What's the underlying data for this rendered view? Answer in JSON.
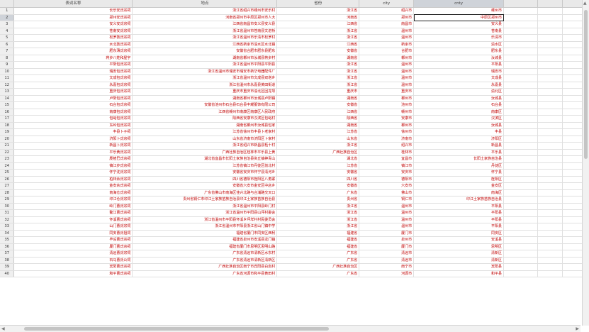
{
  "columns": [
    "表词名称",
    "地点",
    "省份",
    "city",
    "cnty"
  ],
  "rows": [
    [
      "长乐安氏宗祠",
      "浙江省绍兴市嵊州市安乐村",
      "浙江省",
      "绍兴市",
      "嵊州市"
    ],
    [
      "郑州安氏宗祠",
      "河南省郑州市中原区郑州市人大",
      "河南省",
      "郑州市",
      "中原区郑州市"
    ],
    [
      "安义安氏宗祠",
      "江西省南昌市安义县安义县",
      "江西省",
      "南昌市",
      "安义县"
    ],
    [
      "苍南安氏宗祠",
      "浙江省温州市苍南县文进桥",
      "浙江省",
      "温州市",
      "苍南县"
    ],
    [
      "松罗敦氏宗祠",
      "浙江省温州市乐清市松罗村",
      "浙江省",
      "温州市",
      "乐清市"
    ],
    [
      "水北敦氏宗祠",
      "江西省新余市渝水区水北镇",
      "江西省",
      "新余市",
      "渝水区"
    ],
    [
      "肥东薄氏宗祠",
      "安徽省合肥市肥东县肥东",
      "安徽省",
      "合肥市",
      "肥东县"
    ],
    [
      "蒋步八姓和屋宇",
      "湖南省郴州市汝城县蒋步村",
      "湖南省",
      "郴州市",
      "汝城县"
    ],
    [
      "平阳包氏宗祠",
      "浙江省温州市平阳县平阳县",
      "浙江省",
      "温州市",
      "平阳县"
    ],
    [
      "瑞安包氏宗祠",
      "浙江省温州市瑞安市瑞安市新华电器配件厂",
      "浙江省",
      "温州市",
      "瑞安市"
    ],
    [
      "文成包氏宗祠",
      "浙江省温州市文成县双塔乡",
      "浙江省",
      "温州市",
      "文成县"
    ],
    [
      "永嘉包氏宗祠",
      "浙江省温州市永嘉县黄田街道",
      "浙江省",
      "温州市",
      "永嘉县"
    ],
    [
      "重庆包氏宗祠",
      "重庆市重庆市渝北区回龙坝",
      "重庆市",
      "重庆市",
      "渝北区"
    ],
    [
      "卢阳包氏宗祠",
      "湖南省郴州市汝城县卢阳镇",
      "湖南省",
      "郴州市",
      "汝城县"
    ],
    [
      "石台包氏宗祠",
      "安徽省池州市石台县石台县丰耀服饰有限公司",
      "安徽省",
      "池州市",
      "石台县"
    ],
    [
      "南康包氏宗祠",
      "江西省赣州市南康区南康区人民政府",
      "江西省",
      "赣州市",
      "南康区"
    ],
    [
      "包峪包氏宗祠",
      "陕西省安康市汉滨区包峪村",
      "陕西省",
      "安康市",
      "汉滨区"
    ],
    [
      "东岭包氏宗祠",
      "湖南省郴州市汝城县包家",
      "湖南省",
      "郴州市",
      "汝城县"
    ],
    [
      "丰县卜子祠",
      "江苏省徐州市丰县卜老家村",
      "江苏省",
      "徐州市",
      "丰县"
    ],
    [
      "济阳卜氏宗祠",
      "山东省济南市济阳区卜家村",
      "山东省",
      "济南市",
      "济阳区"
    ],
    [
      "新昌卜氏宗祠",
      "浙江省绍兴市新昌县柘十村",
      "浙江省",
      "绍兴市",
      "新昌县"
    ],
    [
      "平乐黄氏宗祠",
      "广西壮族自治区桂林市平乐县上黄",
      "广西壮族自治区",
      "桂林市",
      "平乐县"
    ],
    [
      "麂楂巴氏宗祠",
      "湖北省宜昌市长阳土家族自治县资丘镇神青山",
      "湖北省",
      "宜昌市",
      "长阳土家族自治县"
    ],
    [
      "镇江步氏宗祠",
      "江苏省镇江市丹徒区前北村",
      "江苏省",
      "镇江市",
      "丹徒区"
    ],
    [
      "怀宁沈氏宗祠",
      "安徽省安庆市怀宁县清河乡",
      "安徽省",
      "安庆市",
      "怀宁县"
    ],
    [
      "柏林余氏宗祠",
      "四川省德阳市旌阳区八角寨",
      "四川省",
      "德阳市",
      "旌阳区"
    ],
    [
      "金安余氏宗祠",
      "安徽省六安市金安区中店乡",
      "安徽省",
      "六安市",
      "金安区"
    ],
    [
      "南海仓氏宗祠",
      "广东省佛山市南海区佳兴北路与合浦路交叉口",
      "广东省",
      "佛山市",
      "南海区"
    ],
    [
      "印江仓氏宗祠",
      "贵州省铜仁市印江土家族苗族自治县印江土家族苗族自治县",
      "贵州省",
      "铜仁市",
      "印江土家族苗族自治县"
    ],
    [
      "岭门曹氏宗祠",
      "浙江省温州市平阳县岭门村",
      "浙江省",
      "温州市",
      "平阳县"
    ],
    [
      "鳌江曹氏宗祠",
      "浙江省温州市平阳县山坪村委会",
      "浙江省",
      "温州市",
      "平阳县"
    ],
    [
      "怀溪曹氏宗祠",
      "浙江省温州市平阳县怀溪乡坪垟村村民委员会",
      "浙江省",
      "温州市",
      "平阳县"
    ],
    [
      "山门曹氏宗祠",
      "浙江省温州市平阳县浙江省山门镇中学",
      "浙江省",
      "温州市",
      "平阳县"
    ],
    [
      "同安曹氏祖祠",
      "福建省厦门市同安区西柯",
      "福建省",
      "厦门市",
      "同安区"
    ],
    [
      "毕设曹氏宗祠",
      "福建省泉州市安溪县龙门镇",
      "福建省",
      "泉州市",
      "安溪县"
    ],
    [
      "厦门曹氏宗祠",
      "福建省厦门市思明区思明山路",
      "福建省",
      "厦门市",
      "思明区"
    ],
    [
      "清远曹氏宗祠",
      "广东省清远市清新区水东村",
      "广东省",
      "清远市",
      "清新区"
    ],
    [
      "石马曹氏公祠",
      "广东省清远市清新区清新区",
      "广东省",
      "清远市",
      "清新区"
    ],
    [
      "宾阳曹氏宗祠",
      "广西壮族自治区南宁市宾阳县白岩村",
      "广西壮族自治区",
      "南宁市",
      "宾阳县"
    ],
    [
      "和平曹氏宗祠",
      "广东省河源市和平县黄田村",
      "广东省",
      "河源市",
      "和平县"
    ]
  ]
}
